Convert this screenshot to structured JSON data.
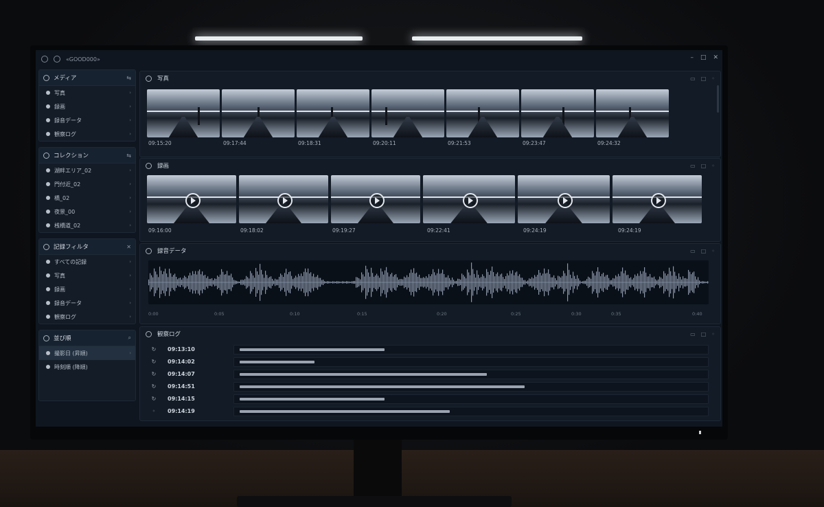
{
  "window": {
    "title": "«GOOD000»",
    "controls": [
      "–",
      "□",
      "✕"
    ]
  },
  "sidebar": {
    "groups": [
      {
        "label": "メディア",
        "action": "⇆",
        "items": [
          {
            "label": "写真",
            "icon": "photo-icon"
          },
          {
            "label": "録画",
            "icon": "video-icon"
          },
          {
            "label": "録音データ",
            "icon": "audio-icon"
          },
          {
            "label": "観察ログ",
            "icon": "log-icon"
          }
        ]
      },
      {
        "label": "コレクション",
        "action": "⇆",
        "items": [
          {
            "label": "湖畔エリア_02"
          },
          {
            "label": "門付近_02"
          },
          {
            "label": "橋_02"
          },
          {
            "label": "夜景_00"
          },
          {
            "label": "桟橋道_02"
          }
        ]
      },
      {
        "label": "記録フィルタ",
        "action": "✕",
        "items": [
          {
            "label": "すべての記録"
          },
          {
            "label": "写真"
          },
          {
            "label": "録画"
          },
          {
            "label": "録音データ"
          },
          {
            "label": "観察ログ"
          }
        ]
      },
      {
        "label": "並び順",
        "action": "⌕",
        "items": [
          {
            "label": "撮影日 (昇順)",
            "active": true
          },
          {
            "label": "時刻順 (降順)"
          }
        ]
      }
    ]
  },
  "panels": {
    "photos": {
      "title": "写真",
      "timestamps": [
        "09:15:20",
        "09:17:44",
        "09:18:31",
        "09:20:11",
        "09:21:53",
        "09:23:47",
        "09:24:32"
      ]
    },
    "videos": {
      "title": "録画",
      "timestamps": [
        "09:16:00",
        "09:18:02",
        "09:19:27",
        "09:22:41",
        "09:24:19",
        "09:24:19"
      ]
    },
    "audio": {
      "title": "録音データ",
      "ticks": [
        "0:00",
        "0:05",
        "0:10",
        "0:15",
        "0:20",
        "0:25",
        "0:30",
        "0:35",
        "0:40"
      ]
    },
    "log": {
      "title": "観察ログ",
      "rows": [
        {
          "time": "09:13:10",
          "fill": 0.31
        },
        {
          "time": "09:14:02",
          "fill": 0.16
        },
        {
          "time": "09:14:07",
          "fill": 0.53
        },
        {
          "time": "09:14:51",
          "fill": 0.61
        },
        {
          "time": "09:14:15",
          "fill": 0.31
        },
        {
          "time": "09:14:19",
          "fill": 0.45
        }
      ]
    }
  },
  "colors": {
    "screen_bg": "#0f1620",
    "panel_bg": "#121b26",
    "accent": "#9aa3b0",
    "desk": "#2a1f19"
  }
}
